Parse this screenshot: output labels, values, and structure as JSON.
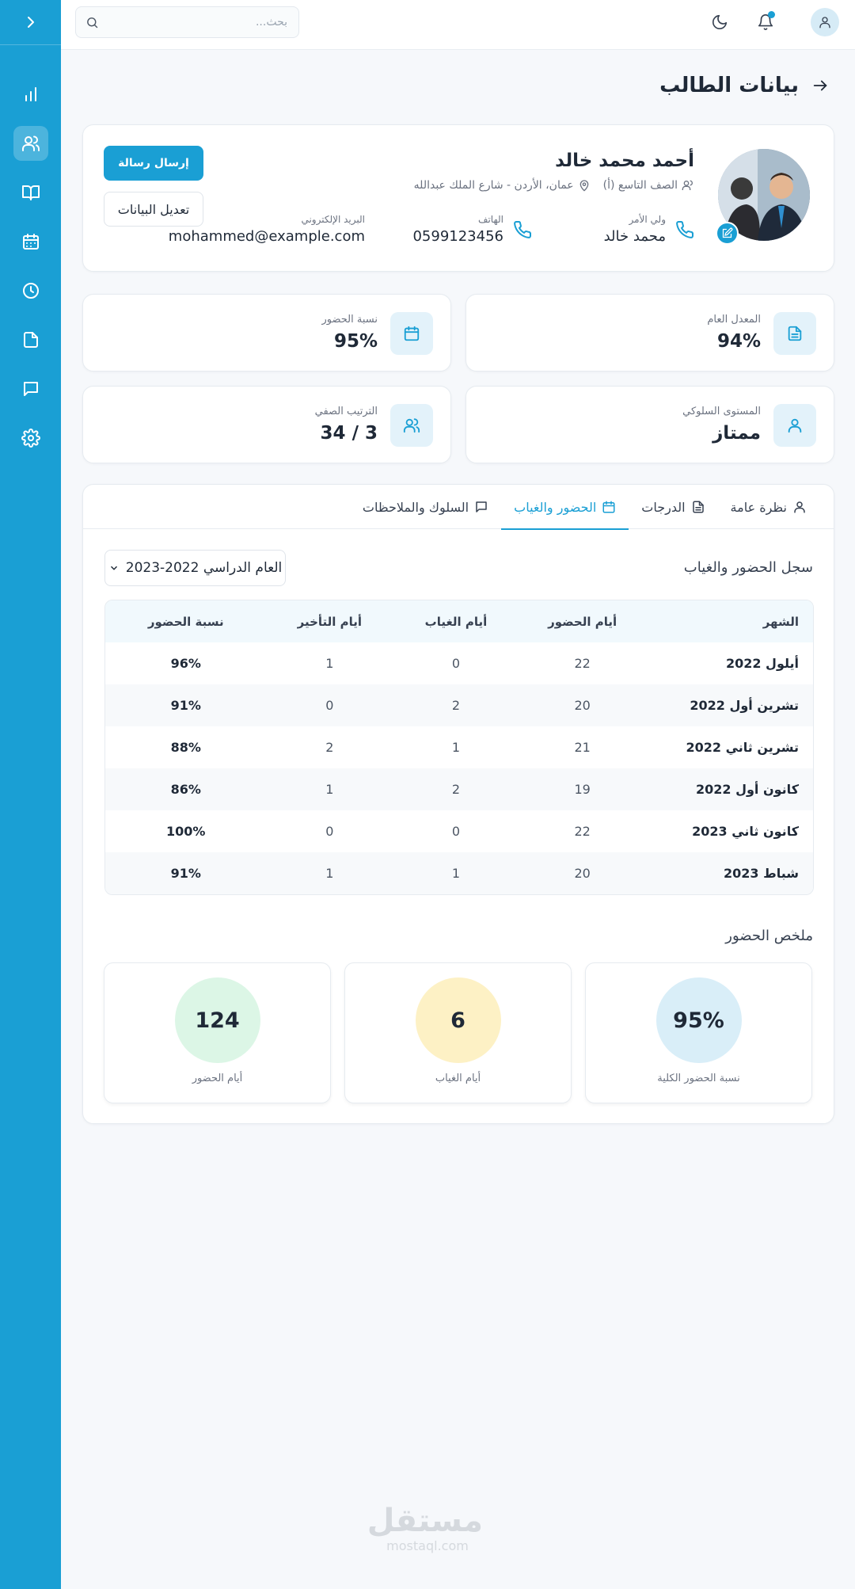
{
  "search": {
    "placeholder": "بحث..."
  },
  "page": {
    "title": "بيانات الطالب"
  },
  "student": {
    "name": "أحمد محمد خالد",
    "class": "الصف التاسع (أ)",
    "location": "عمان، الأردن - شارع الملك عبدالله",
    "guardian_label": "ولي الأمر",
    "guardian_value": "محمد خالد",
    "phone_label": "الهاتف",
    "phone_value": "0599123456",
    "email_label": "البريد الإلكتروني",
    "email_value": "mohammed@example.com"
  },
  "actions": {
    "send_message": "إرسال رسالة",
    "edit": "تعديل البيانات"
  },
  "stats": {
    "gpa": {
      "label": "المعدل العام",
      "value": "94%",
      "icon": "document-icon"
    },
    "attendance": {
      "label": "نسبة الحضور",
      "value": "95%",
      "icon": "calendar-icon"
    },
    "behavior": {
      "label": "المستوى السلوكي",
      "value": "ممتاز",
      "icon": "user-icon"
    },
    "rank": {
      "label": "الترتيب الصفي",
      "value": "3 / 34",
      "icon": "users-icon"
    }
  },
  "tabs": [
    "نظرة عامة",
    "الدرجات",
    "الحضور والغياب",
    "السلوك والملاحظات"
  ],
  "active_tab": "الحضور والغياب",
  "attendance": {
    "title": "سجل الحضور والغياب",
    "year": "العام الدراسي 2022-2023",
    "headers": [
      "الشهر",
      "أيام الحضور",
      "أيام الغياب",
      "أيام التأخير",
      "نسبة الحضور"
    ],
    "rows": [
      [
        "أيلول 2022",
        "22",
        "0",
        "1",
        "96%"
      ],
      [
        "تشرين أول 2022",
        "20",
        "2",
        "0",
        "91%"
      ],
      [
        "تشرين ثاني 2022",
        "21",
        "1",
        "2",
        "88%"
      ],
      [
        "كانون أول 2022",
        "19",
        "2",
        "1",
        "86%"
      ],
      [
        "كانون ثاني 2023",
        "22",
        "0",
        "0",
        "100%"
      ],
      [
        "شباط 2023",
        "20",
        "1",
        "1",
        "91%"
      ]
    ]
  },
  "summary": {
    "title": "ملخص الحضور",
    "overall": {
      "value": "95%",
      "label": "نسبة الحضور الكلية",
      "color": "#d9eef8"
    },
    "absent": {
      "value": "6",
      "label": "أيام الغياب",
      "color": "#fdf1c5"
    },
    "present": {
      "value": "124",
      "label": "أيام الحضور",
      "color": "#dcf6e6"
    }
  },
  "colors": {
    "accent": "#1a9fd4",
    "background": "#f6f8fb"
  },
  "watermark": {
    "arabic": "مستقل",
    "latin": "mostaql.com"
  }
}
